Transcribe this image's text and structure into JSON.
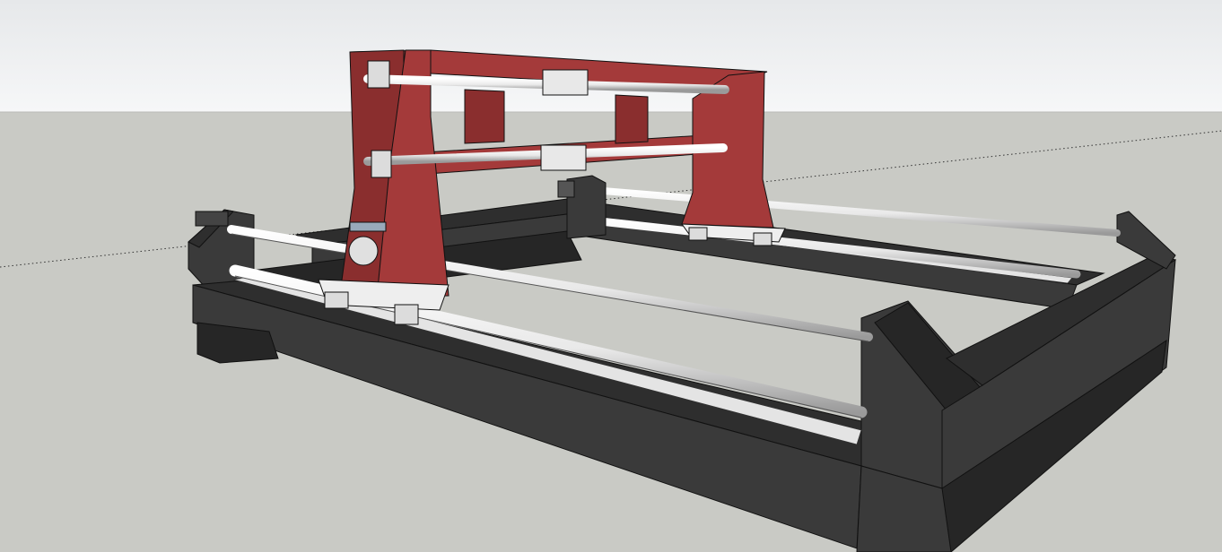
{
  "viewport": {
    "sky_top_color": "#e6e8ea",
    "sky_bottom_color": "#f6f7f8",
    "ground_color": "#c9cac5",
    "axis_color": "#333333"
  },
  "model": {
    "frame_color": "#3a3a3a",
    "frame_dark_color": "#262626",
    "frame_top_color": "#2e2e2e",
    "gantry_color": "#a43a3a",
    "gantry_dark_color": "#8a2e2e",
    "rail_color": "#e4e4e4",
    "rod_color": "#f2f2f2",
    "bearing_color": "#dcdcdc",
    "edge_color": "#111111"
  }
}
